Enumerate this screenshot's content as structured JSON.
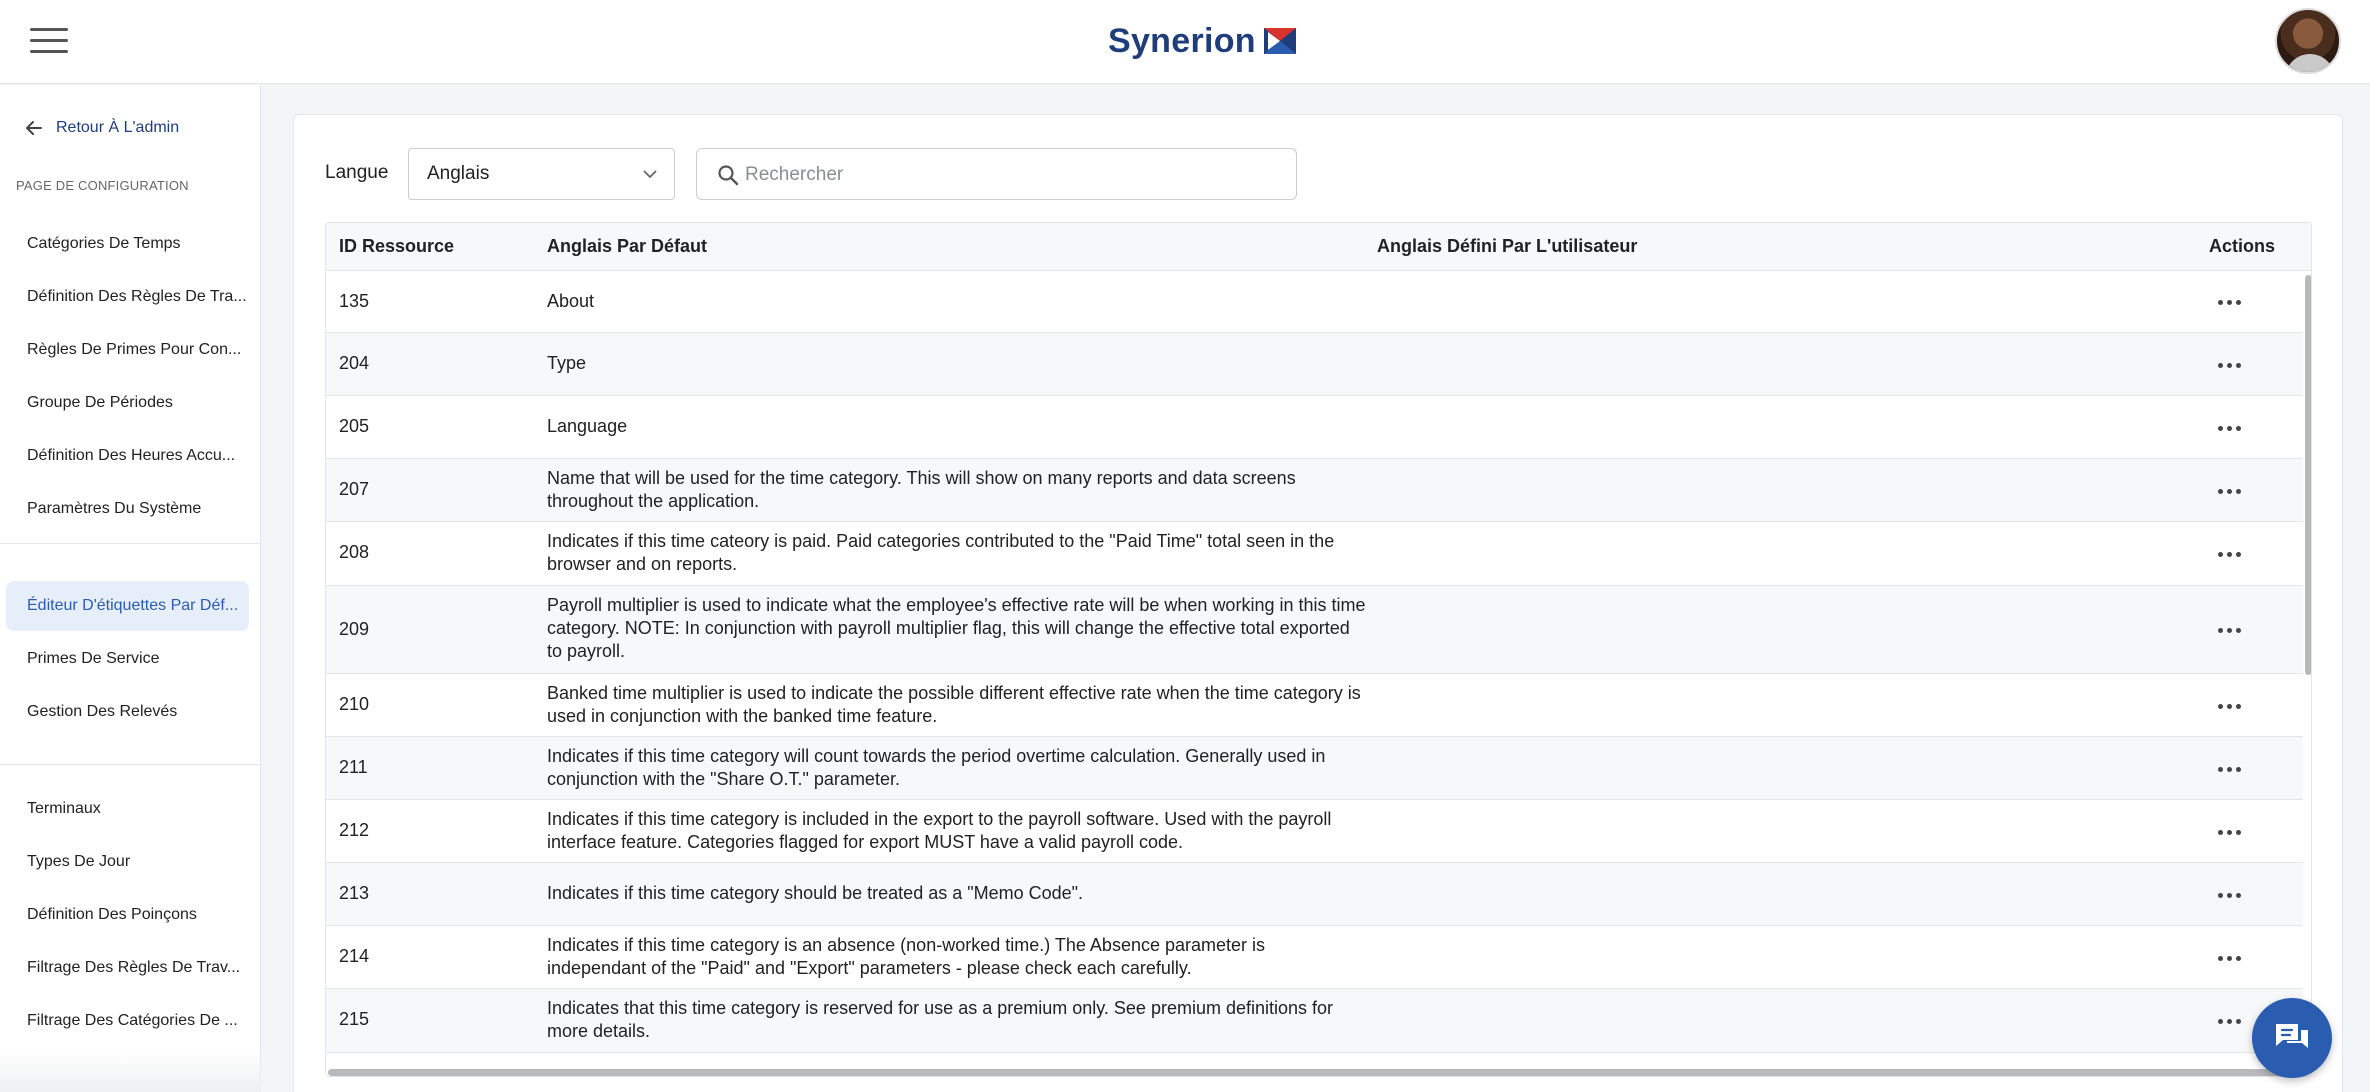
{
  "header": {
    "logo_text": "Synerion",
    "brand_color": "#1f3d7a",
    "accent_color": "#2a5db0"
  },
  "sidebar": {
    "back_label": "Retour À L'admin",
    "section_title": "PAGE DE CONFIGURATION",
    "group1": [
      {
        "label": "Catégories De Temps"
      },
      {
        "label": "Définition Des Règles De Tra..."
      },
      {
        "label": "Règles De Primes Pour Con..."
      },
      {
        "label": "Groupe De Périodes"
      },
      {
        "label": "Définition Des Heures Accu..."
      },
      {
        "label": "Paramètres Du Système"
      }
    ],
    "group2": [
      {
        "label": "Éditeur D'étiquettes Par Déf...",
        "active": true
      },
      {
        "label": "Primes De Service"
      },
      {
        "label": "Gestion Des Relevés"
      }
    ],
    "group3": [
      {
        "label": "Terminaux"
      },
      {
        "label": "Types De Jour"
      },
      {
        "label": "Définition Des Poinçons"
      },
      {
        "label": "Filtrage Des Règles De Trav..."
      },
      {
        "label": "Filtrage Des Catégories De ..."
      }
    ]
  },
  "filters": {
    "language_label": "Langue",
    "language_value": "Anglais",
    "search_placeholder": "Rechercher"
  },
  "table": {
    "columns": [
      "ID Ressource",
      "Anglais Par Défaut",
      "Anglais Défini Par L'utilisateur",
      "Actions"
    ],
    "rows": [
      {
        "id": "135",
        "default": "About",
        "custom": ""
      },
      {
        "id": "204",
        "default": "Type",
        "custom": ""
      },
      {
        "id": "205",
        "default": "Language",
        "custom": ""
      },
      {
        "id": "207",
        "default": "Name that will be used for the time category. This will show on many reports and data screens throughout the application.",
        "custom": ""
      },
      {
        "id": "208",
        "default": "Indicates if this time cateory is paid. Paid categories contributed to the \"Paid Time\" total seen in the browser and on reports.",
        "custom": ""
      },
      {
        "id": "209",
        "default": "Payroll multiplier is used to indicate what the employee's effective rate will be when working in this time category. NOTE: In conjunction with payroll multiplier flag, this will change the effective total exported to payroll.",
        "custom": ""
      },
      {
        "id": "210",
        "default": "Banked time multiplier is used to indicate the possible different effective rate when the time category is used in conjunction with the banked time feature.",
        "custom": ""
      },
      {
        "id": "211",
        "default": "Indicates if this time category will count towards the period overtime calculation. Generally used in conjunction with the \"Share O.T.\" parameter.",
        "custom": ""
      },
      {
        "id": "212",
        "default": "Indicates if this time category is included in the export to the payroll software. Used with the payroll interface feature. Categories flagged for export MUST have a valid payroll code.",
        "custom": ""
      },
      {
        "id": "213",
        "default": "Indicates if this time category should be treated as a \"Memo Code\".",
        "custom": ""
      },
      {
        "id": "214",
        "default": "Indicates if this time category is an absence (non-worked time.) The Absence parameter is independant of the \"Paid\" and \"Export\" parameters - please check each carefully.",
        "custom": ""
      },
      {
        "id": "215",
        "default": "Indicates that this time category is reserved for use as a premium only. See premium definitions for more details.",
        "custom": ""
      }
    ]
  }
}
